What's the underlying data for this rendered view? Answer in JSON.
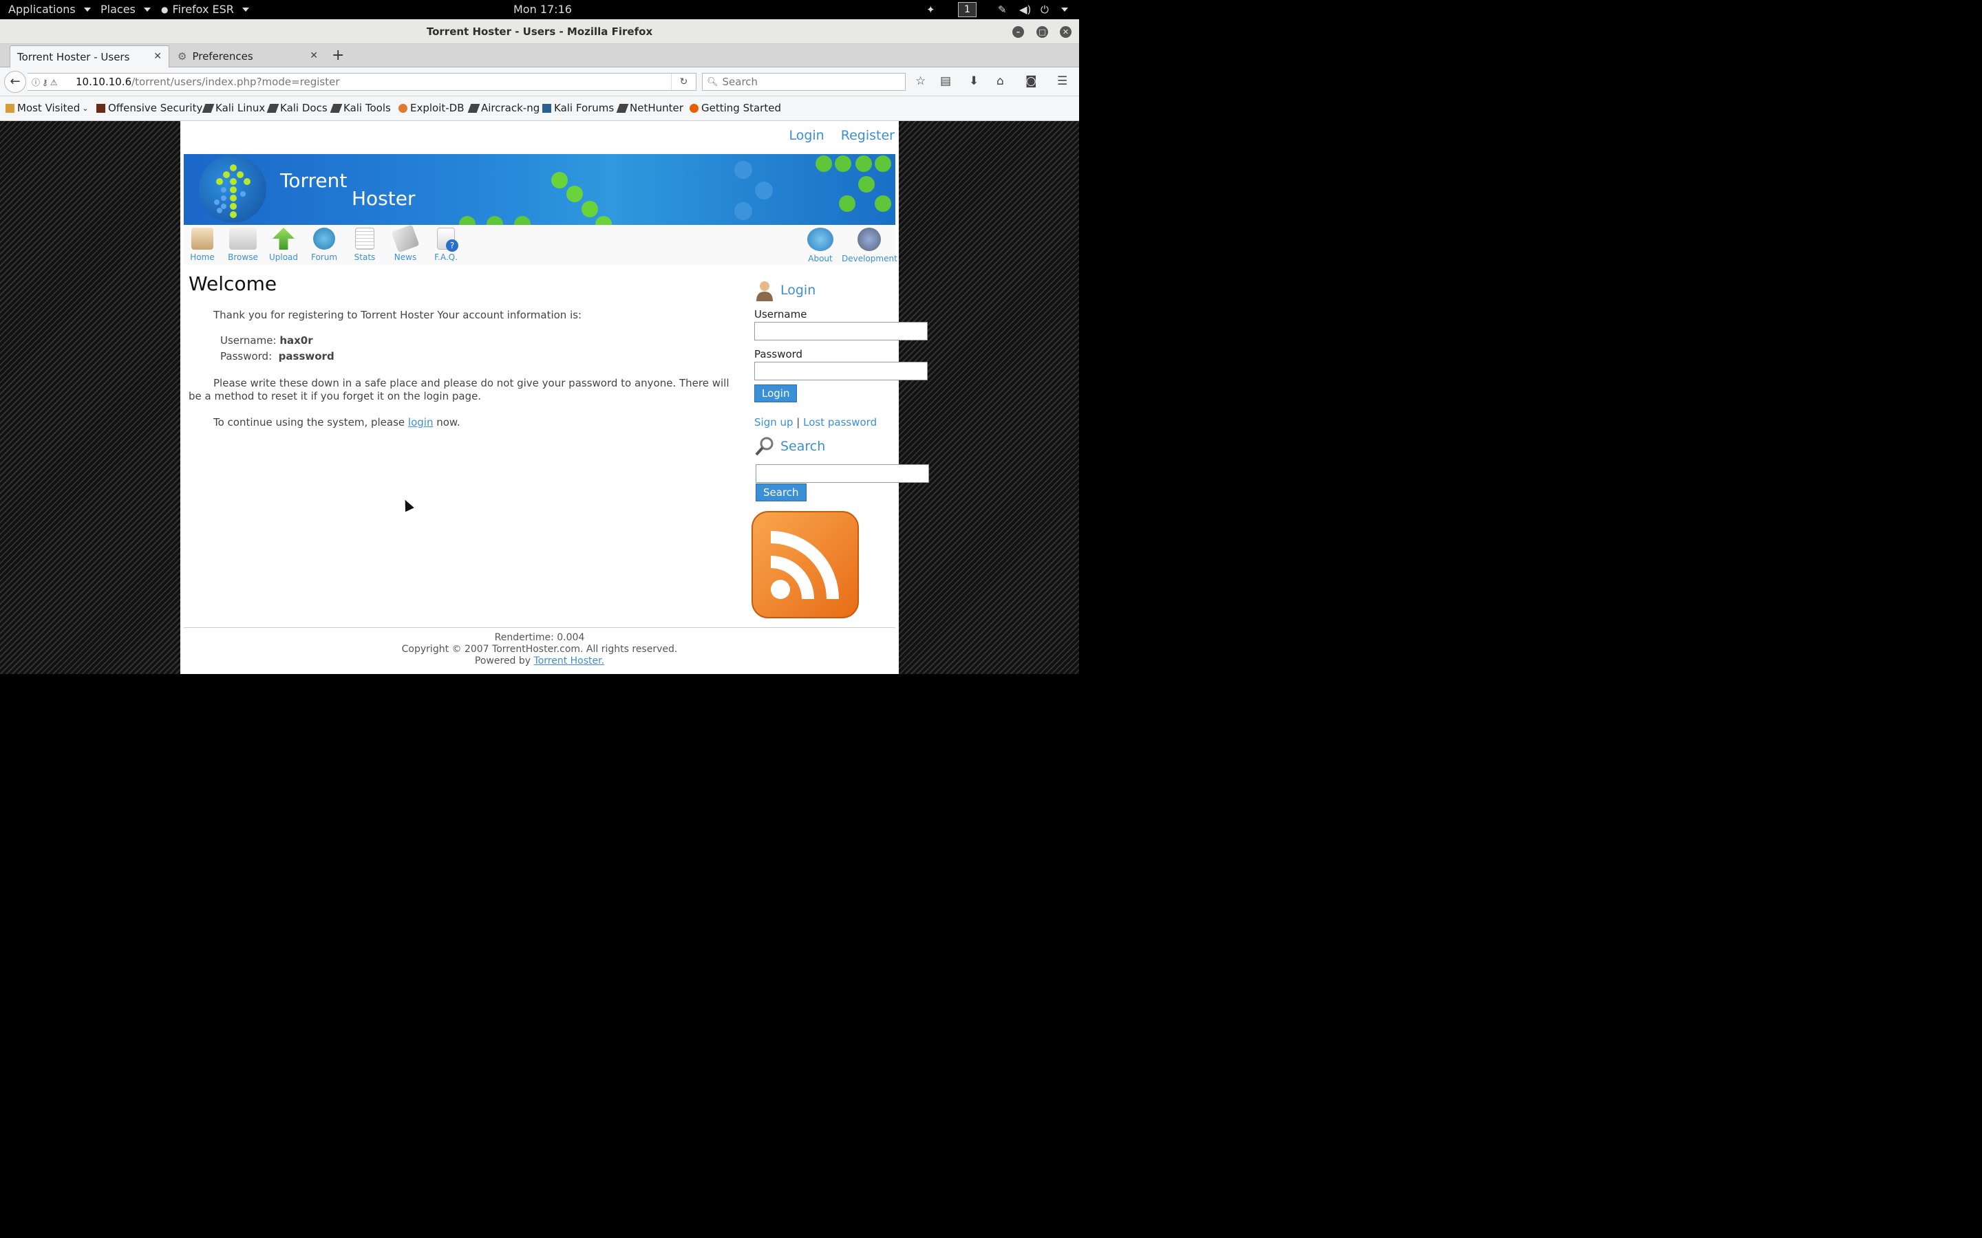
{
  "topbar": {
    "applications": "Applications",
    "places": "Places",
    "firefox": "Firefox ESR",
    "clock": "Mon 17:16",
    "workspace": "1"
  },
  "window": {
    "title": "Torrent Hoster - Users - Mozilla Firefox"
  },
  "tabs": [
    {
      "label": "Torrent Hoster - Users"
    },
    {
      "label": "Preferences"
    }
  ],
  "navbar": {
    "url_host": "10.10.10.6",
    "url_path": "/torrent/users/index.php?mode=register",
    "search_placeholder": "Search"
  },
  "bookmarks": [
    {
      "label": "Most Visited"
    },
    {
      "label": "Offensive Security"
    },
    {
      "label": "Kali Linux"
    },
    {
      "label": "Kali Docs"
    },
    {
      "label": "Kali Tools"
    },
    {
      "label": "Exploit-DB"
    },
    {
      "label": "Aircrack-ng"
    },
    {
      "label": "Kali Forums"
    },
    {
      "label": "NetHunter"
    },
    {
      "label": "Getting Started"
    }
  ],
  "site": {
    "top_login": "Login",
    "top_register": "Register",
    "banner_line1": "Torrent",
    "banner_line2": "Hoster",
    "nav": [
      {
        "label": "Home"
      },
      {
        "label": "Browse"
      },
      {
        "label": "Upload"
      },
      {
        "label": "Forum"
      },
      {
        "label": "Stats"
      },
      {
        "label": "News"
      },
      {
        "label": "F.A.Q."
      },
      {
        "label": "About"
      },
      {
        "label": "Development"
      }
    ]
  },
  "main": {
    "heading": "Welcome",
    "intro": "Thank you for registering to Torrent Hoster Your account information is:",
    "username_label": "Username:",
    "username_value": "hax0r",
    "password_label": "Password:",
    "password_value": "password",
    "warning": "Please write these down in a safe place and please do not give your password to anyone. There will be a method to reset it if you forget it on the login page.",
    "continue_pre": "To continue using the system, please",
    "continue_link": "login",
    "continue_post": "now."
  },
  "sidebar": {
    "login_heading": "Login",
    "username_label": "Username",
    "password_label": "Password",
    "login_button": "Login",
    "signup_link": "Sign up",
    "separator": "|",
    "lost_password_link": "Lost password",
    "search_heading": "Search",
    "search_button": "Search"
  },
  "footer": {
    "rendertime": "Rendertime: 0.004",
    "copyright": "Copyright © 2007 TorrentHoster.com. All rights reserved.",
    "powered_pre": "Powered by",
    "powered_link": "Torrent Hoster."
  },
  "colors": {
    "link": "#3a8fd6",
    "banner": "#2584d8",
    "rss": "#f08a30"
  }
}
